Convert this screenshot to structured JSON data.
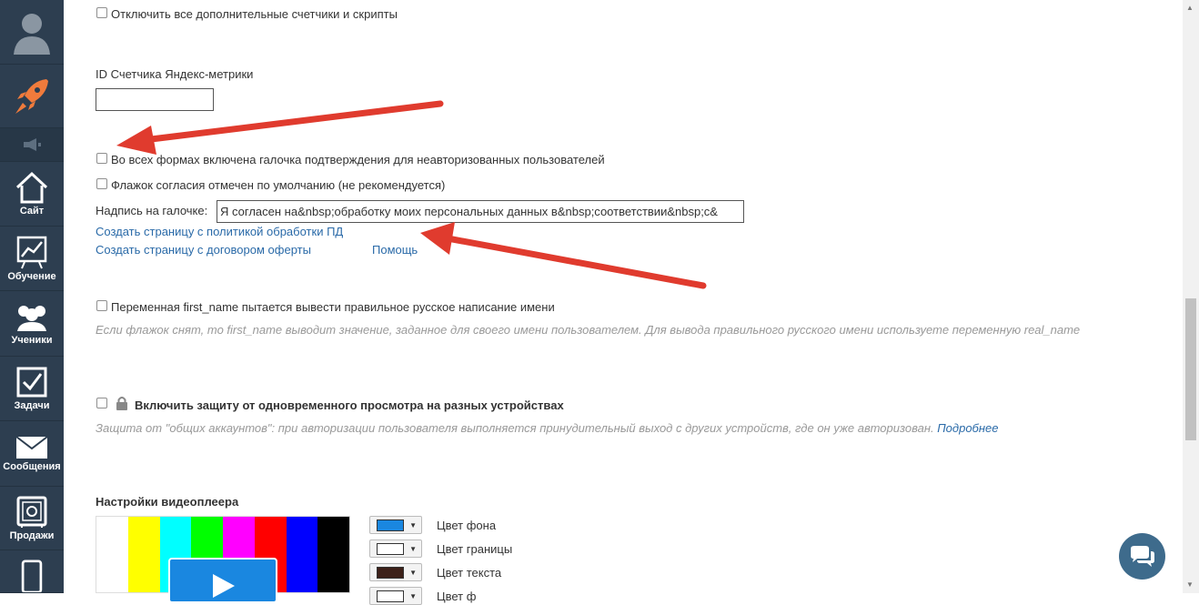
{
  "sidebar": {
    "items": [
      {
        "label": "",
        "icon": "avatar-icon"
      },
      {
        "label": "",
        "icon": "rocket-icon"
      },
      {
        "label": "",
        "icon": "megaphone-icon"
      },
      {
        "label": "Сайт",
        "icon": "house-icon"
      },
      {
        "label": "Обучение",
        "icon": "chart-board-icon"
      },
      {
        "label": "Ученики",
        "icon": "users-icon"
      },
      {
        "label": "Задачи",
        "icon": "checkbox-icon"
      },
      {
        "label": "Сообщения",
        "icon": "envelope-icon"
      },
      {
        "label": "Продажи",
        "icon": "safe-icon"
      },
      {
        "label": "",
        "icon": "phone-icon"
      }
    ]
  },
  "settings": {
    "disable_counters": "Отключить все дополнительные счетчики и скрипты",
    "metrika_label": "ID Счетчика Яндекс-метрики",
    "metrika_value": "",
    "confirm_checkbox": "Во всех формах включена галочка подтверждения для неавторизованных пользователей",
    "consent_default": "Флажок согласия отмечен по умолчанию (не рекомендуется)",
    "checkbox_caption_label": "Надпись на галочке:",
    "checkbox_caption_value": "Я согласен на&nbsp;обработку моих персональных данных в&nbsp;соответствии&nbsp;с&",
    "create_policy_link": "Создать страницу с политикой обработки ПД",
    "create_offer_link": "Создать страницу с договором оферты",
    "help_link": "Помощь",
    "first_name_checkbox": "Переменная first_name пытается вывести правильное русское написание имени",
    "first_name_hint": "Если флажок снят, то first_name выводит значение, заданное для своего имени пользователем. Для вывода правильного русского имени используете переменную real_name",
    "protection_checkbox": "Включить защиту от одновременного просмотра на разных устройствах",
    "protection_hint": "Защита от \"общих аккаунтов\": при авторизации пользователя выполняется принудительный выход с других устройств, где он уже авторизован.",
    "protection_more_link": "Подробнее"
  },
  "video_player": {
    "title": "Настройки видеоплеера",
    "color_bars": [
      "#ffffff",
      "#ffff00",
      "#00ffff",
      "#00ff00",
      "#ff00ff",
      "#ff0000",
      "#0000ff",
      "#000000"
    ],
    "colors": [
      {
        "label": "Цвет фона",
        "value": "#1a87e0"
      },
      {
        "label": "Цвет границы",
        "value": "#ffffff"
      },
      {
        "label": "Цвет текста",
        "value": "#3d2119"
      },
      {
        "label": "Цвет ф",
        "value": "#ffffff"
      }
    ]
  },
  "chat_button": {
    "icon": "chat-bubbles-icon",
    "color": "#3e6b8c"
  }
}
